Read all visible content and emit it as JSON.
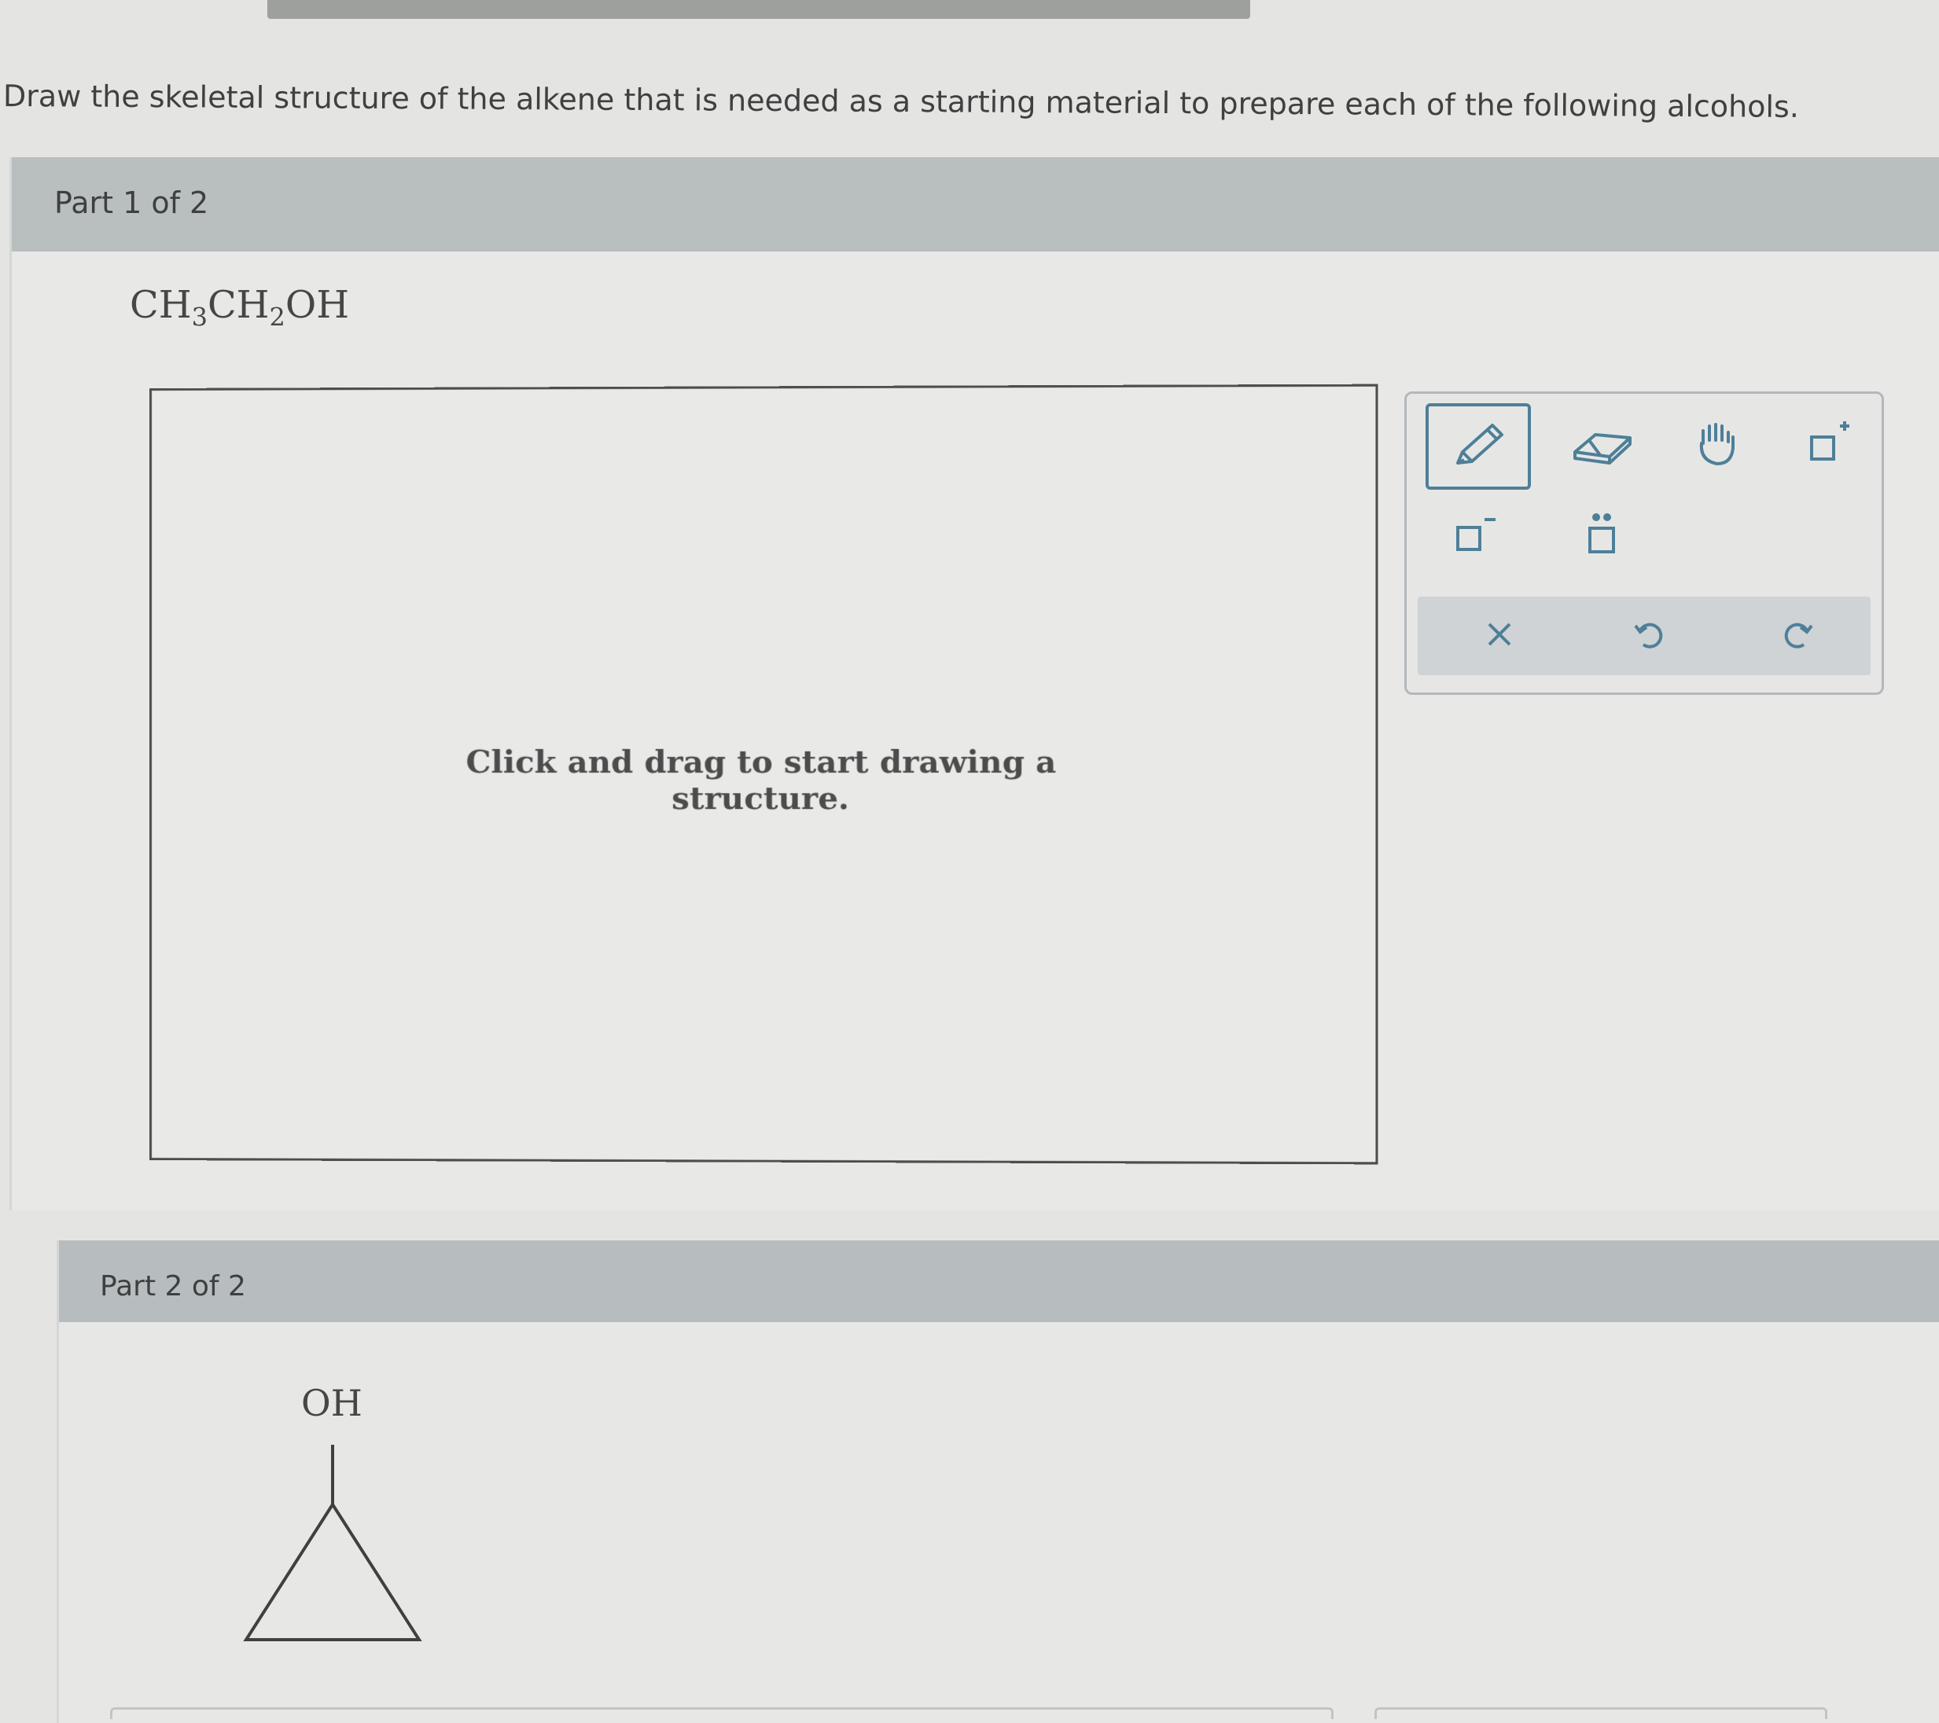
{
  "instruction": "Draw the skeletal structure of the alkene that is needed as a starting material to prepare each of the following alcohols.",
  "part1": {
    "header": "Part 1 of 2",
    "formula": {
      "ch": "CH",
      "sub3": "3",
      "ch2": "CH",
      "sub2": "2",
      "oh": "OH"
    },
    "canvas_hint": "Click and drag to start drawing a structure."
  },
  "toolbar": {
    "tools": [
      "pencil-icon",
      "eraser-icon",
      "hand-icon",
      "add-positive-charge-icon",
      "add-negative-charge-icon",
      "add-lone-pair-icon"
    ],
    "actions": [
      "clear-icon",
      "undo-icon",
      "redo-icon"
    ],
    "accent_color": "#4f7f98"
  },
  "part2": {
    "header": "Part 2 of 2",
    "molecule_label": "OH"
  }
}
